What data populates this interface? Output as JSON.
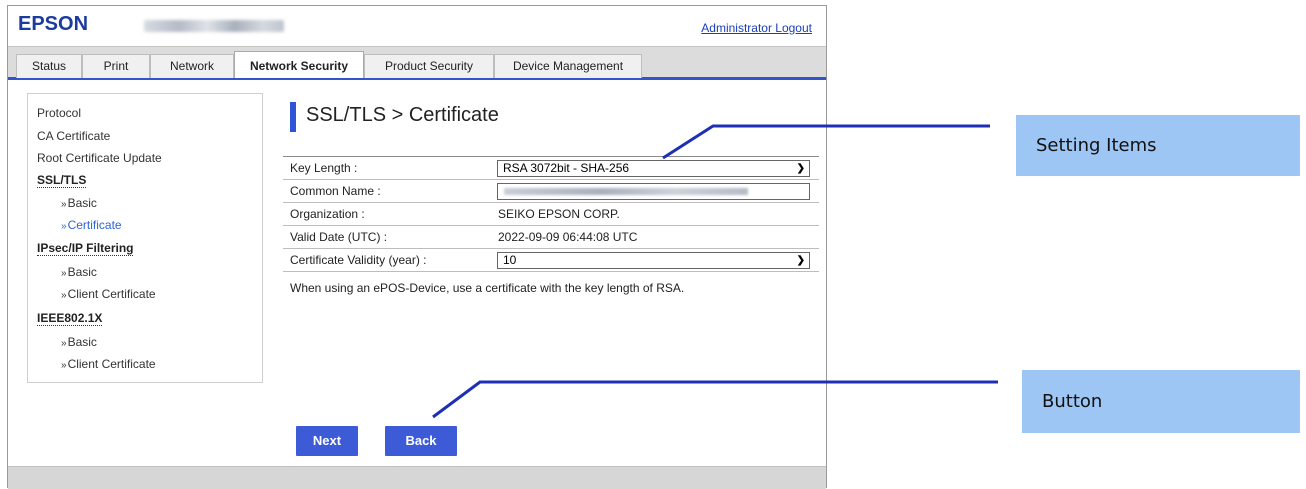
{
  "header": {
    "logo": "EPSON",
    "logout_label": "Administrator Logout"
  },
  "tabs": [
    {
      "label": "Status"
    },
    {
      "label": "Print"
    },
    {
      "label": "Network"
    },
    {
      "label": "Network Security",
      "active": true
    },
    {
      "label": "Product Security"
    },
    {
      "label": "Device Management"
    }
  ],
  "sidebar": {
    "items": [
      {
        "label": "Protocol"
      },
      {
        "label": "CA Certificate"
      },
      {
        "label": "Root Certificate Update"
      },
      {
        "label": "SSL/TLS"
      },
      {
        "label": "Basic"
      },
      {
        "label": "Certificate"
      },
      {
        "label": "IPsec/IP Filtering"
      },
      {
        "label": "Basic"
      },
      {
        "label": "Client Certificate"
      },
      {
        "label": "IEEE802.1X"
      },
      {
        "label": "Basic"
      },
      {
        "label": "Client Certificate"
      }
    ],
    "sub_prefix": "»"
  },
  "page": {
    "title": "SSL/TLS > Certificate"
  },
  "form": {
    "key_length": {
      "label": "Key Length :",
      "value": "RSA 3072bit - SHA-256"
    },
    "common_name": {
      "label": "Common Name :"
    },
    "organization": {
      "label": "Organization :",
      "value": "SEIKO EPSON CORP."
    },
    "valid_date": {
      "label": "Valid Date (UTC) :",
      "value": "2022-09-09 06:44:08 UTC"
    },
    "validity": {
      "label": "Certificate Validity (year) :",
      "value": "10"
    },
    "note": "When using an ePOS-Device, use a certificate with the key length of RSA."
  },
  "buttons": {
    "next": "Next",
    "back": "Back"
  },
  "callouts": {
    "setting_items": "Setting Items",
    "button": "Button"
  },
  "colors": {
    "accent": "#3d5bd6",
    "callout": "#9ec6f4",
    "link": "#1a3fb8"
  }
}
